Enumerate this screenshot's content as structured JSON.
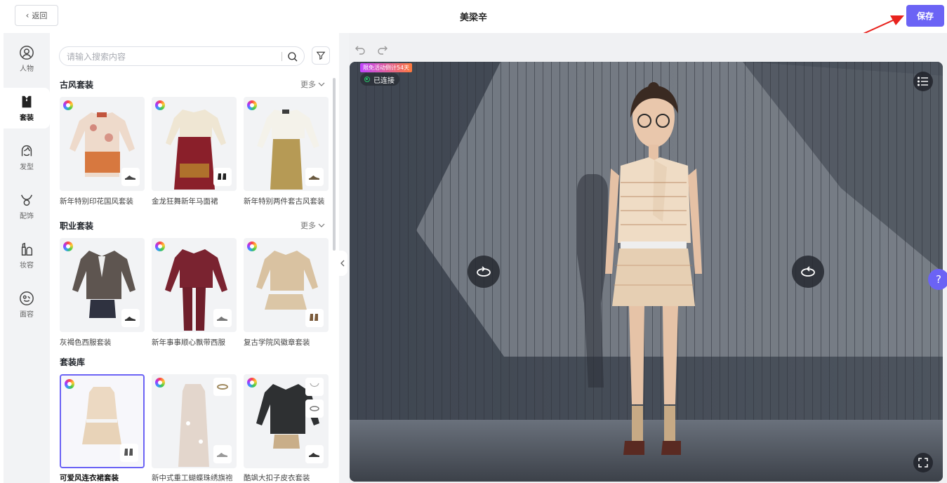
{
  "header": {
    "back_label": "返回",
    "title": "美梁辛",
    "save_label": "保存"
  },
  "rail": {
    "items": [
      {
        "label": "人物",
        "icon": "person-icon"
      },
      {
        "label": "套装",
        "icon": "outfit-icon",
        "active": true
      },
      {
        "label": "发型",
        "icon": "hairstyle-icon"
      },
      {
        "label": "配饰",
        "icon": "accessory-icon"
      },
      {
        "label": "妆容",
        "icon": "makeup-icon"
      },
      {
        "label": "面容",
        "icon": "face-icon"
      }
    ]
  },
  "search": {
    "placeholder": "请输入搜索内容"
  },
  "sections": [
    {
      "title": "古风套装",
      "more": "更多",
      "cards": [
        {
          "label": "新年特别印花国风套装"
        },
        {
          "label": "金龙狂舞新年马面裙"
        },
        {
          "label": "新年特别两件套古风套装"
        }
      ]
    },
    {
      "title": "职业套装",
      "more": "更多",
      "cards": [
        {
          "label": "灰褐色西服套装"
        },
        {
          "label": "新年事事顺心飘带西服"
        },
        {
          "label": "复古学院风徽章套装"
        }
      ]
    },
    {
      "title": "套装库",
      "cards": [
        {
          "label": "可爱风连衣裙套装",
          "selected": true
        },
        {
          "label": "新中式重工蝴蝶珠绣旗袍"
        },
        {
          "label": "酷飒大扣子皮衣套装"
        }
      ]
    }
  ],
  "stage": {
    "promo": "限免活动倒计54天",
    "status": "已连接",
    "help": "?"
  },
  "colors": {
    "accent": "#6b63f5",
    "connected": "#27c46b"
  }
}
